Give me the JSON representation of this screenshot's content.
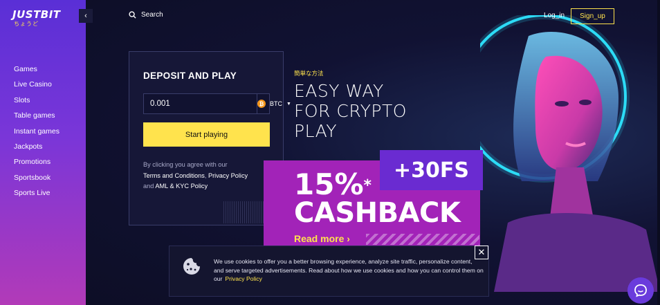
{
  "brand": {
    "logo": "JUSTBIT",
    "logo_sub": "ちょうど"
  },
  "sidebar": {
    "collapse_glyph": "‹",
    "items": [
      {
        "label": "Games"
      },
      {
        "label": "Live Casino"
      },
      {
        "label": "Slots"
      },
      {
        "label": "Table games"
      },
      {
        "label": "Instant games"
      },
      {
        "label": "Jackpots"
      },
      {
        "label": "Promotions"
      },
      {
        "label": "Sportsbook"
      },
      {
        "label": "Sports Live"
      }
    ]
  },
  "header": {
    "search_label": "Search",
    "login_label": "Log_in",
    "signup_label": "Sign_up"
  },
  "deposit": {
    "title": "DEPOSIT AND PLAY",
    "amount_value": "0.001",
    "currency": "BTC",
    "currency_icon_glyph": "₿",
    "start_label": "Start playing",
    "terms_prefix": "By clicking you agree with our",
    "terms_link": "Terms and Conditions",
    "terms_sep": ", ",
    "privacy_link": "Privacy Policy",
    "and_text": "and ",
    "aml_link": "AML & KYC Policy"
  },
  "hero": {
    "subtitle": "簡単な方法",
    "title_lines": [
      "EASY WAY",
      "FOR CRYPTO",
      "PLAY"
    ],
    "cashback_percent": "15%",
    "cashback_asterisk": "*",
    "cashback_word": "CASHBACK",
    "fs_badge": "+30FS",
    "read_more": "Read more ›"
  },
  "cookie": {
    "text": "We use cookies to offer you a better browsing experience, analyze site traffic, personalize content, and serve targeted advertisements. Read about how we use cookies and how you can control them on our",
    "link": "Privacy Policy",
    "close_glyph": "✕"
  },
  "colors": {
    "accent_yellow": "#ffe34d",
    "promo_pink": "#a223b8",
    "badge_purple": "#6a2bd1",
    "sidebar_top": "#5a2fd6",
    "sidebar_bottom": "#b23ab8"
  }
}
